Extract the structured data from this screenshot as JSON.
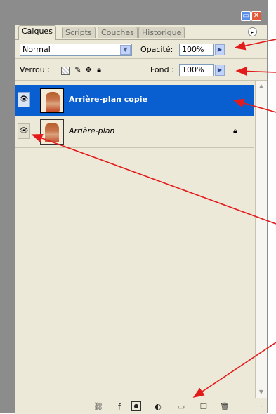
{
  "tabs": [
    {
      "label": "Calques",
      "active": true
    },
    {
      "label": "Scripts",
      "active": false
    },
    {
      "label": "Couches",
      "active": false
    },
    {
      "label": "Historique",
      "active": false
    }
  ],
  "panel_menu_icon": "▸",
  "window": {
    "minimize_icon": "▭",
    "close_icon": "✕"
  },
  "blend": {
    "value": "Normal",
    "dropdown_icon": "chevron-down-icon"
  },
  "opacity": {
    "label": "Opacité:",
    "value": "100%"
  },
  "lock": {
    "label": "Verrou :",
    "icons": [
      "lock-transparency-icon",
      "lock-paint-icon",
      "lock-move-icon",
      "lock-all-icon"
    ]
  },
  "fill": {
    "label": "Fond :",
    "value": "100%"
  },
  "layers": [
    {
      "name": "Arrière-plan copie",
      "selected": true,
      "visible": true,
      "locked": false
    },
    {
      "name": "Arrière-plan",
      "selected": false,
      "visible": true,
      "locked": true
    }
  ],
  "bottom_icons": [
    "link-icon",
    "layer-style-icon",
    "mask-icon",
    "adjustment-icon",
    "folder-icon",
    "new-layer-icon",
    "trash-icon"
  ],
  "colors": {
    "selection": "#0a5fd0",
    "annotation_arrow": "#e31b1b",
    "panel_bg": "#ece9d8"
  }
}
